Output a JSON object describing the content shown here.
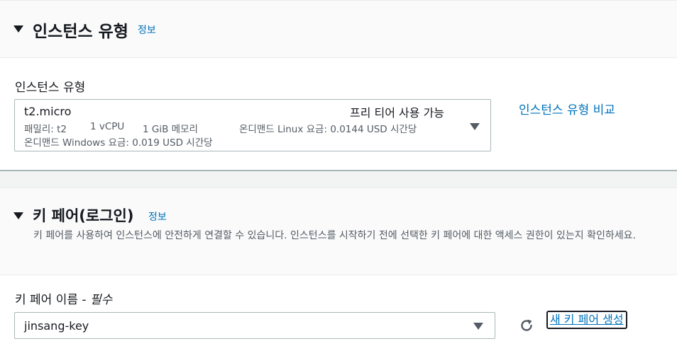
{
  "instance_type_section": {
    "title": "인스턴스 유형",
    "info_link": "정보",
    "field_label": "인스턴스 유형",
    "selected": {
      "name": "t2.micro",
      "free_tier": "프리 티어 사용 가능",
      "family": "패밀리: t2",
      "vcpu": "1 vCPU",
      "memory": "1 GiB 메모리",
      "linux_price": "온디맨드 Linux 요금: 0.0144 USD 시간당",
      "windows_price": "온디맨드 Windows 요금: 0.019 USD 시간당"
    },
    "compare_link": "인스턴스 유형 비교"
  },
  "key_pair_section": {
    "title": "키 페어(로그인)",
    "info_link": "정보",
    "description": "키 페어를 사용하여 인스턴스에 안전하게 연결할 수 있습니다. 인스턴스를 시작하기 전에 선택한 키 페어에 대한 액세스 권한이 있는지 확인하세요.",
    "field_label": "키 페어 이름 - ",
    "field_required": "필수",
    "selected_value": "jinsang-key",
    "create_button": "새 키 페어 생성"
  },
  "icons": {
    "collapse": "caret-down-icon",
    "dropdown": "dropdown-caret-icon",
    "refresh": "refresh-icon"
  },
  "colors": {
    "link": "#0073bb",
    "text": "#16191f",
    "secondary_text": "#545b64",
    "header_bg": "#fafafa"
  }
}
